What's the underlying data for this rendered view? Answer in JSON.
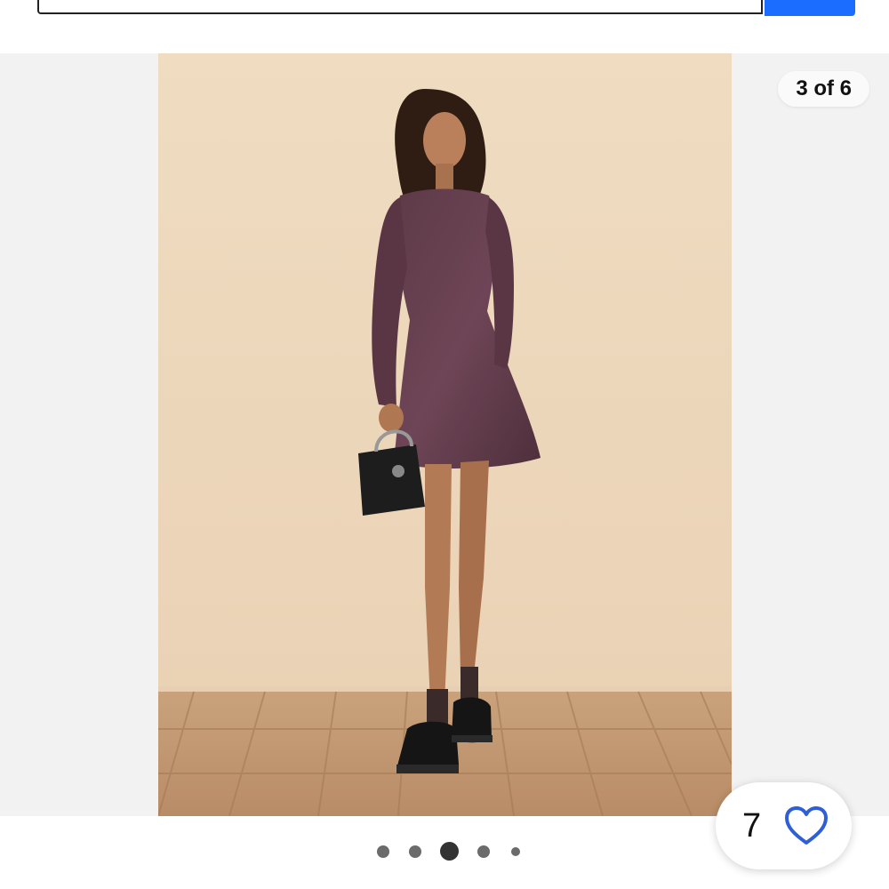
{
  "gallery": {
    "counter_text": "3 of 6",
    "current_index": 3,
    "total": 6
  },
  "like": {
    "count": "7",
    "icon": "heart-outline-icon",
    "color": "#2f5fd6"
  },
  "colors": {
    "search_button": "#1a6dff",
    "gallery_bg": "#f2f2f2"
  }
}
